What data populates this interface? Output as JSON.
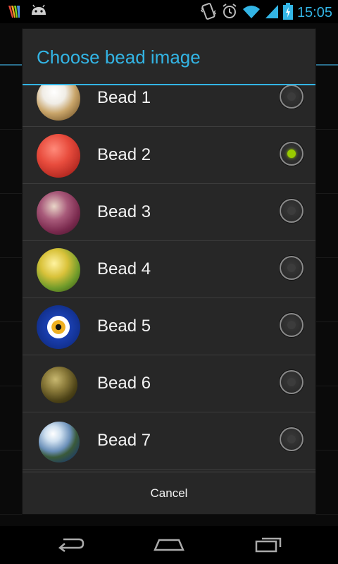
{
  "status_bar": {
    "time": "15:05",
    "icons": [
      "color-bars-icon",
      "android-icon",
      "vibrate-icon",
      "alarm-icon",
      "wifi-icon",
      "signal-icon",
      "battery-charging-icon"
    ]
  },
  "dialog": {
    "title": "Choose bead image",
    "cancel_label": "Cancel",
    "items": [
      {
        "label": "Bead 1",
        "selected": false,
        "thumb": "bead-1-icon"
      },
      {
        "label": "Bead 2",
        "selected": true,
        "thumb": "bead-2-icon"
      },
      {
        "label": "Bead 3",
        "selected": false,
        "thumb": "bead-3-icon"
      },
      {
        "label": "Bead 4",
        "selected": false,
        "thumb": "bead-4-icon"
      },
      {
        "label": "Bead 5",
        "selected": false,
        "thumb": "bead-5-icon"
      },
      {
        "label": "Bead 6",
        "selected": false,
        "thumb": "bead-6-icon"
      },
      {
        "label": "Bead 7",
        "selected": false,
        "thumb": "bead-7-icon"
      }
    ]
  },
  "nav_bar": {
    "icons": [
      "back-icon",
      "home-icon",
      "recent-apps-icon"
    ]
  },
  "colors": {
    "accent": "#33b5e5",
    "radio_checked": "#99cc00",
    "dialog_bg": "#272727"
  }
}
